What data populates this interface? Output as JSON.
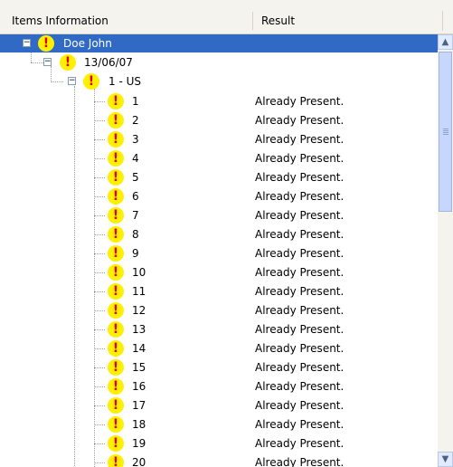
{
  "header": {
    "col_items": "Items Information",
    "col_result": "Result"
  },
  "tree": {
    "root": {
      "label": "Doe John",
      "icon": "warning-icon",
      "expanded": true,
      "selected": true
    },
    "date": {
      "label": "13/06/07",
      "icon": "warning-icon",
      "expanded": true
    },
    "group": {
      "label": "1 - US",
      "icon": "warning-icon",
      "expanded": true
    },
    "items": [
      {
        "label": "1",
        "result": "Already Present."
      },
      {
        "label": "2",
        "result": "Already Present."
      },
      {
        "label": "3",
        "result": "Already Present."
      },
      {
        "label": "4",
        "result": "Already Present."
      },
      {
        "label": "5",
        "result": "Already Present."
      },
      {
        "label": "6",
        "result": "Already Present."
      },
      {
        "label": "7",
        "result": "Already Present."
      },
      {
        "label": "8",
        "result": "Already Present."
      },
      {
        "label": "9",
        "result": "Already Present."
      },
      {
        "label": "10",
        "result": "Already Present."
      },
      {
        "label": "11",
        "result": "Already Present."
      },
      {
        "label": "12",
        "result": "Already Present."
      },
      {
        "label": "13",
        "result": "Already Present."
      },
      {
        "label": "14",
        "result": "Already Present."
      },
      {
        "label": "15",
        "result": "Already Present."
      },
      {
        "label": "16",
        "result": "Already Present."
      },
      {
        "label": "17",
        "result": "Already Present."
      },
      {
        "label": "18",
        "result": "Already Present."
      },
      {
        "label": "19",
        "result": "Already Present."
      },
      {
        "label": "20",
        "result": "Already Present."
      }
    ]
  },
  "glyphs": {
    "warning": "!",
    "minus": "−",
    "scroll_up": "▲",
    "scroll_down": "▼"
  },
  "colors": {
    "selection": "#316ac5",
    "warning_fill": "#ffef00",
    "warning_mark": "#e00000"
  }
}
